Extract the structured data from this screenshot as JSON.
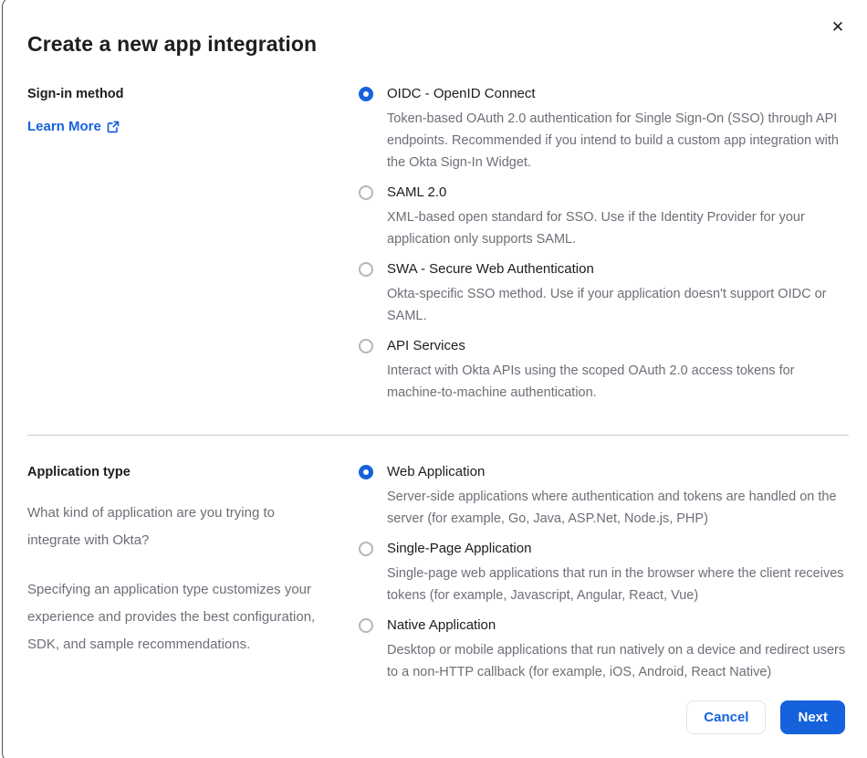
{
  "modal": {
    "title": "Create a new app integration",
    "close_icon": "✕"
  },
  "signin_section": {
    "label": "Sign-in method",
    "learn_more_label": "Learn More",
    "options": [
      {
        "label": "OIDC - OpenID Connect",
        "description": "Token-based OAuth 2.0 authentication for Single Sign-On (SSO) through API endpoints. Recommended if you intend to build a custom app integration with the Okta Sign-In Widget.",
        "selected": true
      },
      {
        "label": "SAML 2.0",
        "description": "XML-based open standard for SSO. Use if the Identity Provider for your application only supports SAML.",
        "selected": false
      },
      {
        "label": "SWA - Secure Web Authentication",
        "description": "Okta-specific SSO method. Use if your application doesn't support OIDC or SAML.",
        "selected": false
      },
      {
        "label": "API Services",
        "description": "Interact with Okta APIs using the scoped OAuth 2.0 access tokens for machine-to-machine authentication.",
        "selected": false
      }
    ]
  },
  "apptype_section": {
    "label": "Application type",
    "paragraphs": {
      "p1": "What kind of application are you trying to integrate with Okta?",
      "p2": "Specifying an application type customizes your experience and provides the best configuration, SDK, and sample recommendations."
    },
    "options": [
      {
        "label": "Web Application",
        "description": "Server-side applications where authentication and tokens are handled on the server (for example, Go, Java, ASP.Net, Node.js, PHP)",
        "selected": true
      },
      {
        "label": "Single-Page Application",
        "description": "Single-page web applications that run in the browser where the client receives tokens (for example, Javascript, Angular, React, Vue)",
        "selected": false
      },
      {
        "label": "Native Application",
        "description": "Desktop or mobile applications that run natively on a device and redirect users to a non-HTTP callback (for example, iOS, Android, React Native)",
        "selected": false
      }
    ]
  },
  "footer": {
    "cancel_label": "Cancel",
    "next_label": "Next"
  },
  "colors": {
    "accent_blue": "#1662dd",
    "text_dark": "#1d1d21",
    "text_gray": "#6e6e78",
    "divider": "#c9c9ce",
    "modal_border": "#4e4e52"
  }
}
